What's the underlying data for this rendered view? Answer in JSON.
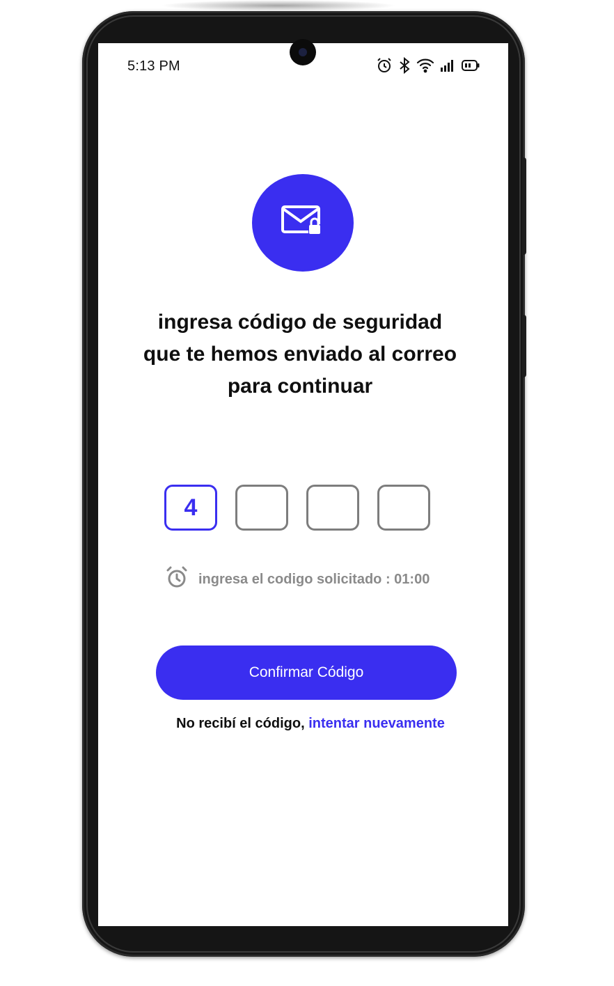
{
  "status_bar": {
    "time": "5:13 PM",
    "icons": [
      "alarm-icon",
      "bluetooth-icon",
      "wifi-icon",
      "signal-icon",
      "battery-icon"
    ]
  },
  "hero": {
    "icon": "mail-lock-icon",
    "title": "ingresa código de seguridad que te hemos enviado al correo para continuar"
  },
  "code": {
    "digits": [
      "4",
      "",
      "",
      ""
    ]
  },
  "timer": {
    "icon": "alarm-clock-icon",
    "label": "ingresa el codigo solicitado : 01:00"
  },
  "actions": {
    "confirm_label": "Confirmar Código",
    "resend_prefix": "No recibí el código,",
    "resend_link": "intentar nuevamente"
  },
  "colors": {
    "accent": "#3a2ef0",
    "muted": "#8a8a8a",
    "text": "#0f0f0f"
  }
}
